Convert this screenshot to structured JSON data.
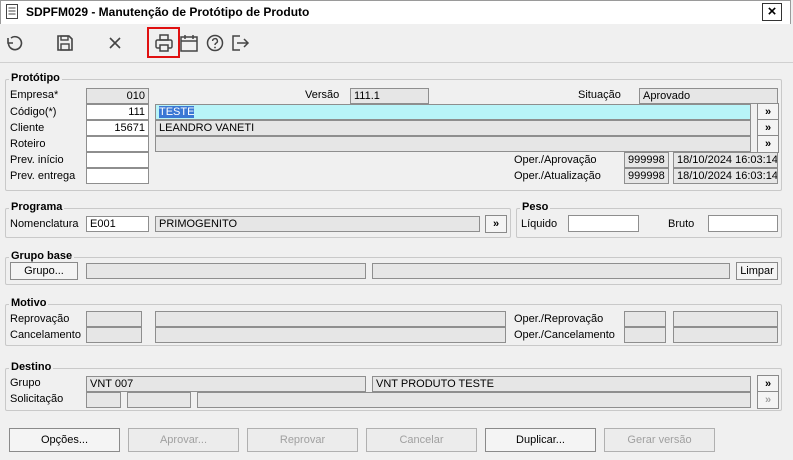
{
  "window": {
    "title": "SDPFM029 - Manutenção de Protótipo de Produto",
    "close": "×"
  },
  "toolbar": {
    "icons": [
      "undo-icon",
      "save-icon",
      "cancel-icon",
      "print-icon",
      "calendar-icon",
      "help-icon",
      "exit-icon"
    ],
    "highlighted": "print-icon",
    "highlight_color": "#e01010"
  },
  "prototipo": {
    "legend": "Protótipo",
    "empresa_label": "Empresa*",
    "empresa": "010",
    "versao_label": "Versão",
    "versao": "111.1",
    "situacao_label": "Situação",
    "situacao": "Aprovado",
    "codigo_label": "Código(*)",
    "codigo": "111",
    "codigo_desc": "TESTE",
    "cliente_label": "Cliente",
    "cliente": "15671",
    "cliente_desc": "LEANDRO VANETI",
    "roteiro_label": "Roteiro",
    "roteiro": "",
    "roteiro_desc": "",
    "prev_inicio_label": "Prev. início",
    "prev_inicio": "",
    "prev_entrega_label": "Prev. entrega",
    "prev_entrega": "",
    "oper_aprov_label": "Oper./Aprovação",
    "oper_aprov_user": "999998",
    "oper_aprov_date": "18/10/2024 16:03:14",
    "oper_atual_label": "Oper./Atualização",
    "oper_atual_user": "999998",
    "oper_atual_date": "18/10/2024 16:03:14",
    "lookup": "»"
  },
  "programa": {
    "legend": "Programa",
    "nomenclatura_label": "Nomenclatura",
    "nomenclatura": "E001",
    "nomenclatura_desc": "PRIMOGENITO",
    "lookup": "»"
  },
  "peso": {
    "legend": "Peso",
    "liquido_label": "Líquido",
    "liquido": "",
    "bruto_label": "Bruto",
    "bruto": ""
  },
  "grupo_base": {
    "legend": "Grupo base",
    "grupo_button": "Grupo...",
    "field1": "",
    "field2": "",
    "limpar_button": "Limpar"
  },
  "motivo": {
    "legend": "Motivo",
    "reprovacao_label": "Reprovação",
    "cancelamento_label": "Cancelamento",
    "oper_reprov_label": "Oper./Reprovação",
    "oper_cancel_label": "Oper./Cancelamento"
  },
  "destino": {
    "legend": "Destino",
    "grupo_label": "Grupo",
    "grupo_code": "VNT 007",
    "grupo_desc": "VNT PRODUTO TESTE",
    "solicitacao_label": "Solicitação",
    "lookup": "»"
  },
  "footer": {
    "opcoes": "Opções...",
    "aprovar": "Aprovar...",
    "reprovar": "Reprovar",
    "cancelar": "Cancelar",
    "duplicar": "Duplicar...",
    "gerar_versao": "Gerar versão"
  }
}
